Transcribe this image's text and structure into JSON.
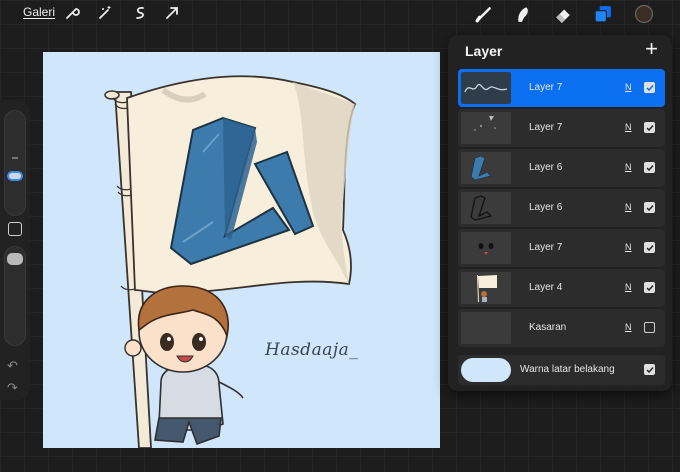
{
  "topbar": {
    "gallery_label": "Galeri",
    "left_tools": [
      "wrench-icon",
      "magic-wand-icon",
      "selection-icon",
      "transform-arrow-icon"
    ],
    "right_tools": [
      "brush-icon",
      "smudge-icon",
      "eraser-icon",
      "layers-icon",
      "color-swatch"
    ]
  },
  "colors": {
    "accent": "#0b6ff2",
    "canvas_bg": "#cfe6fb",
    "current_color": "#3b2d26",
    "flag": "#f7efdc",
    "logo": "#3c7bab"
  },
  "canvas": {
    "signature": "Hasdaaja_"
  },
  "layers": {
    "title": "Layer",
    "add_icon": "plus-icon",
    "items": [
      {
        "name": "Layer 7",
        "blend": "N",
        "visible": true,
        "active": true
      },
      {
        "name": "Layer 7",
        "blend": "N",
        "visible": true,
        "active": false
      },
      {
        "name": "Layer 6",
        "blend": "N",
        "visible": true,
        "active": false
      },
      {
        "name": "Layer 6",
        "blend": "N",
        "visible": true,
        "active": false
      },
      {
        "name": "Layer 7",
        "blend": "N",
        "visible": true,
        "active": false
      },
      {
        "name": "Layer 4",
        "blend": "N",
        "visible": true,
        "active": false
      },
      {
        "name": "Kasaran",
        "blend": "N",
        "visible": false,
        "active": false
      }
    ],
    "background": {
      "label": "Warna latar belakang",
      "visible": true
    }
  }
}
